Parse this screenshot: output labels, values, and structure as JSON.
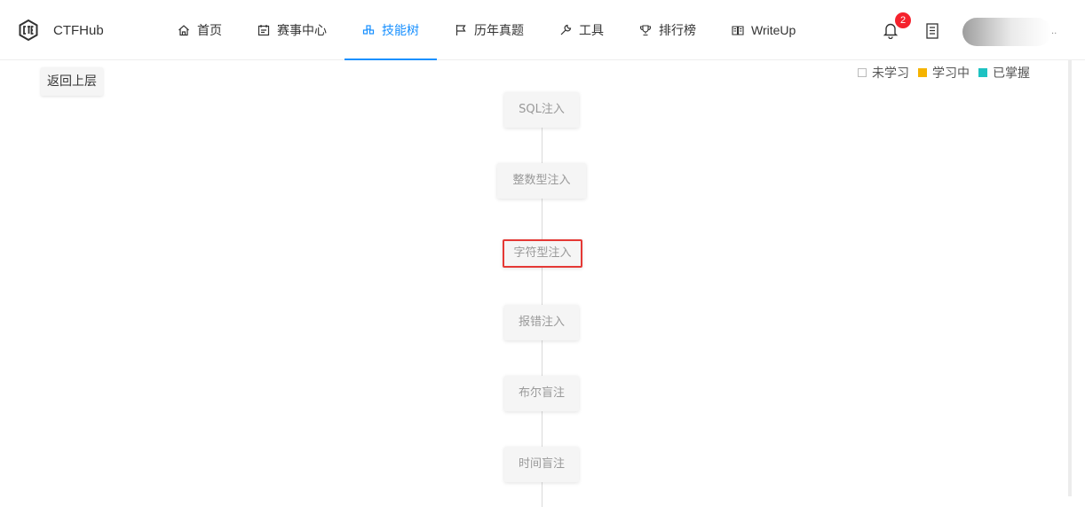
{
  "app": {
    "brand": "CTFHub"
  },
  "nav": {
    "items": [
      {
        "label": "首页",
        "icon": "home-icon"
      },
      {
        "label": "赛事中心",
        "icon": "calendar-icon"
      },
      {
        "label": "技能树",
        "icon": "tree-icon",
        "active": true
      },
      {
        "label": "历年真题",
        "icon": "flag-icon"
      },
      {
        "label": "工具",
        "icon": "wrench-icon"
      },
      {
        "label": "排行榜",
        "icon": "trophy-icon"
      },
      {
        "label": "WriteUp",
        "icon": "book-open-icon"
      }
    ]
  },
  "header": {
    "notification_count": "2",
    "avatar_suffix": ".."
  },
  "back_button": {
    "label": "返回上层"
  },
  "legend": {
    "items": [
      {
        "label": "未学习",
        "color": "#ffffff"
      },
      {
        "label": "学习中",
        "color": "#f5b300"
      },
      {
        "label": "已掌握",
        "color": "#1ec2c2"
      }
    ]
  },
  "tree": {
    "nodes": [
      {
        "label": "SQL注入"
      },
      {
        "label": "整数型注入"
      },
      {
        "label": "字符型注入",
        "highlighted": true
      },
      {
        "label": "报错注入"
      },
      {
        "label": "布尔盲注"
      },
      {
        "label": "时间盲注"
      }
    ]
  },
  "colors": {
    "accent": "#1890ff",
    "badge": "#f5222d",
    "highlight_border": "#e53935"
  }
}
